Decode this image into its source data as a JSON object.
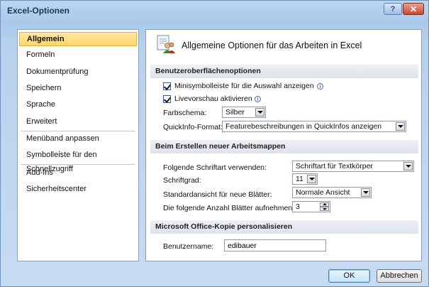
{
  "window": {
    "title": "Excel-Optionen",
    "help_label": "?",
    "close_label": "✕"
  },
  "sidebar": {
    "items": [
      {
        "label": "Allgemein"
      },
      {
        "label": "Formeln"
      },
      {
        "label": "Dokumentprüfung"
      },
      {
        "label": "Speichern"
      },
      {
        "label": "Sprache"
      },
      {
        "label": "Erweitert"
      },
      {
        "label": "Menüband anpassen"
      },
      {
        "label": "Symbolleiste für den Schnellzugriff"
      },
      {
        "label": "Add-Ins"
      },
      {
        "label": "Sicherheitscenter"
      }
    ],
    "selected_index": 0
  },
  "main": {
    "page_title": "Allgemeine Optionen für das Arbeiten in Excel",
    "page_icon": "options-people-icon",
    "sections": {
      "ui": {
        "heading": "Benutzeroberflächenoptionen",
        "mini_toolbar_label": "Minisymbolleiste für die Auswahl anzeigen",
        "mini_toolbar_checked": true,
        "live_preview_label": "Livevorschau aktivieren",
        "live_preview_checked": true,
        "color_scheme_label": "Farbschema:",
        "color_scheme_value": "Silber",
        "screentip_label": "QuickInfo-Format:",
        "screentip_value": "Featurebeschreibungen in QuickInfos anzeigen"
      },
      "new_workbooks": {
        "heading": "Beim Erstellen neuer Arbeitsmappen",
        "font_label": "Folgende Schriftart verwenden:",
        "font_value": "Schriftart für Textkörper",
        "font_size_label": "Schriftgrad:",
        "font_size_value": "11",
        "default_view_label": "Standardansicht für neue Blätter:",
        "default_view_value": "Normale Ansicht",
        "sheet_count_label": "Die folgende Anzahl Blätter aufnehmen:",
        "sheet_count_value": "3"
      },
      "personalize": {
        "heading": "Microsoft Office-Kopie personalisieren",
        "username_label": "Benutzername:",
        "username_value": "edibauer"
      }
    }
  },
  "footer": {
    "ok_label": "OK",
    "cancel_label": "Abbrechen"
  },
  "colors": {
    "selected_bg": "#ffd66e",
    "title_text": "#1e3456"
  }
}
